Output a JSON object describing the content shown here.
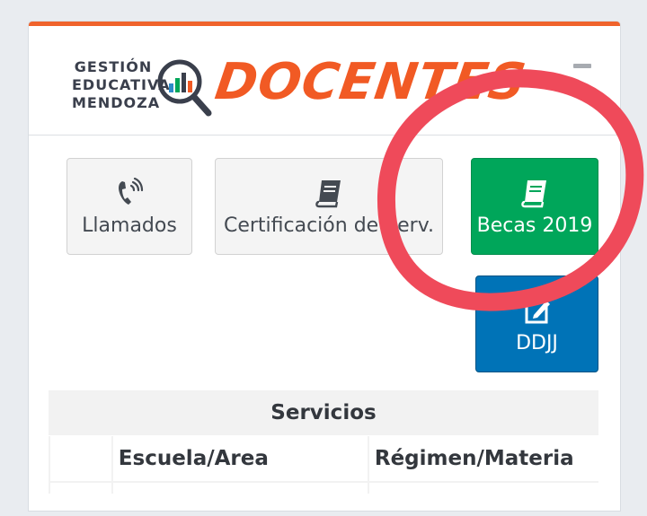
{
  "header": {
    "brand_lines": [
      "GESTIÓN",
      "EDUCATIVA",
      "MENDOZA"
    ],
    "app_title": "DOCENTES",
    "collapse_icon": "minus-icon"
  },
  "buttons": [
    {
      "label": "Llamados",
      "icon": "phone-volume-icon"
    },
    {
      "label": "Certificación de Serv.",
      "icon": "book-icon"
    },
    {
      "label": "Becas 2019",
      "icon": "book-icon",
      "color": "#00a65a"
    },
    {
      "label": "DDJJ",
      "icon": "edit-icon",
      "color": "#0073b7"
    }
  ],
  "table": {
    "title": "Servicios",
    "columns": [
      "",
      "Escuela/Area",
      "Régimen/Materia"
    ]
  },
  "colors": {
    "accent": "#f15a24",
    "success": "#00a65a",
    "primary": "#0073b7",
    "annotation": "#ef4a5a"
  }
}
